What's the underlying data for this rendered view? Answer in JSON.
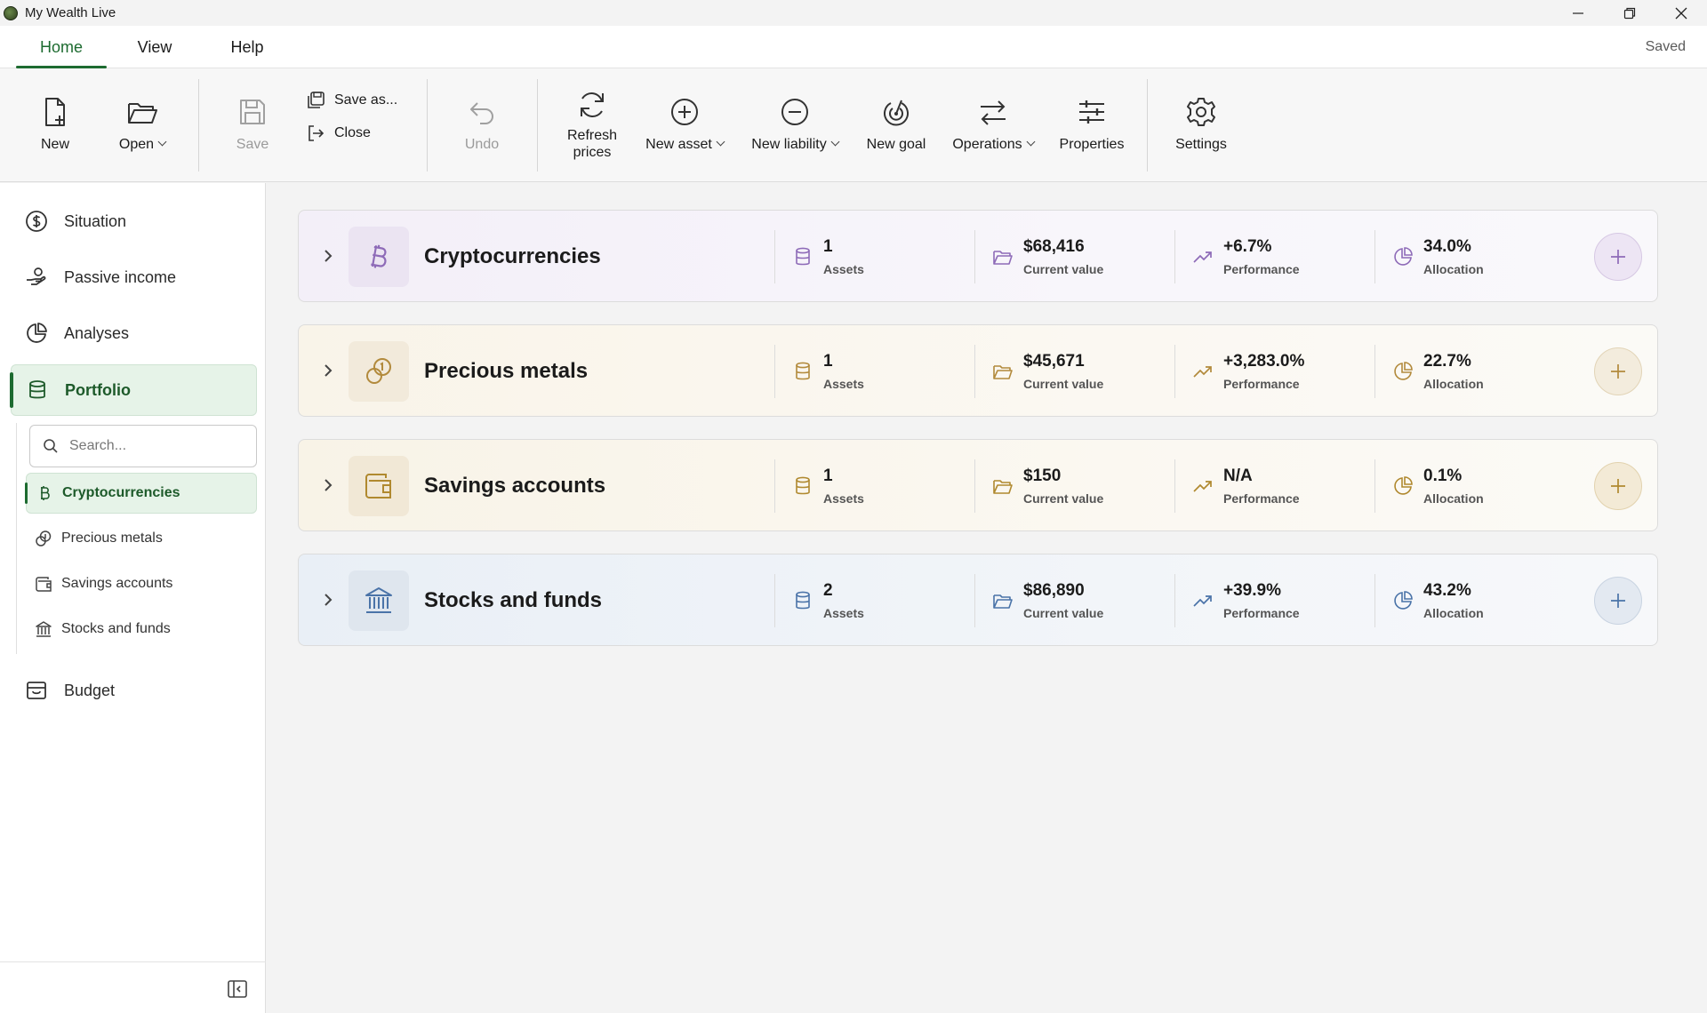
{
  "window": {
    "title": "My Wealth Live",
    "status": "Saved"
  },
  "menu": {
    "tabs": [
      "Home",
      "View",
      "Help"
    ],
    "active": "Home"
  },
  "ribbon": {
    "new": "New",
    "open": "Open",
    "save": "Save",
    "save_as": "Save as...",
    "close": "Close",
    "undo": "Undo",
    "refresh_line1": "Refresh",
    "refresh_line2": "prices",
    "new_asset": "New asset",
    "new_liability": "New liability",
    "new_goal": "New goal",
    "operations": "Operations",
    "properties": "Properties",
    "settings": "Settings"
  },
  "sidebar": {
    "items": [
      "Situation",
      "Passive income",
      "Analyses",
      "Portfolio",
      "Budget"
    ],
    "active": "Portfolio",
    "search_placeholder": "Search...",
    "sub_items": [
      "Cryptocurrencies",
      "Precious metals",
      "Savings accounts",
      "Stocks and funds"
    ],
    "active_sub": "Cryptocurrencies"
  },
  "labels": {
    "assets": "Assets",
    "current_value": "Current value",
    "performance": "Performance",
    "allocation": "Allocation"
  },
  "categories": [
    {
      "name": "Cryptocurrencies",
      "assets": "1",
      "current_value": "$68,416",
      "performance": "+6.7%",
      "allocation": "34.0%",
      "accent": "#8e6bb8",
      "icon": "bitcoin-icon"
    },
    {
      "name": "Precious metals",
      "assets": "1",
      "current_value": "$45,671",
      "performance": "+3,283.0%",
      "allocation": "22.7%",
      "accent": "#b28a3c",
      "icon": "coins-icon"
    },
    {
      "name": "Savings accounts",
      "assets": "1",
      "current_value": "$150",
      "performance": "N/A",
      "allocation": "0.1%",
      "accent": "#b0892f",
      "icon": "wallet-icon"
    },
    {
      "name": "Stocks and funds",
      "assets": "2",
      "current_value": "$86,890",
      "performance": "+39.9%",
      "allocation": "43.2%",
      "accent": "#4a73a8",
      "icon": "bank-icon"
    }
  ],
  "colors": {
    "brand_green": "#1d6b30",
    "active_bg": "#e6f3e8"
  }
}
